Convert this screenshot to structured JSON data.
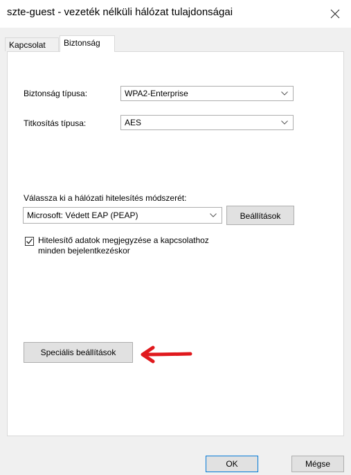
{
  "window": {
    "title": "szte-guest - vezeték nélküli hálózat tulajdonságai"
  },
  "tabs": [
    {
      "label": "Kapcsolat",
      "active": false
    },
    {
      "label": "Biztonság",
      "active": true
    }
  ],
  "security": {
    "security_type_label": "Biztonság típusa:",
    "security_type_value": "WPA2-Enterprise",
    "encryption_type_label": "Titkosítás típusa:",
    "encryption_type_value": "AES",
    "auth_method_label": "Válassza ki a hálózati hitelesítés módszerét:",
    "auth_method_value": "Microsoft: Védett EAP (PEAP)",
    "settings_button": "Beállítások",
    "remember_checkbox_line1": "Hitelesítő adatok megjegyzése a kapcsolathoz",
    "remember_checkbox_line2": "minden bejelentkezéskor",
    "remember_checked": true,
    "advanced_button": "Speciális beállítások"
  },
  "footer": {
    "ok": "OK",
    "cancel": "Mégse"
  },
  "colors": {
    "arrow": "#e0191d",
    "panel_bg": "#ffffff",
    "window_bg": "#f0f0f0"
  },
  "icons": {
    "close": "close-icon",
    "chevron": "chevron-down-icon",
    "check": "checkmark-icon",
    "arrow": "red-arrow-left-icon"
  }
}
